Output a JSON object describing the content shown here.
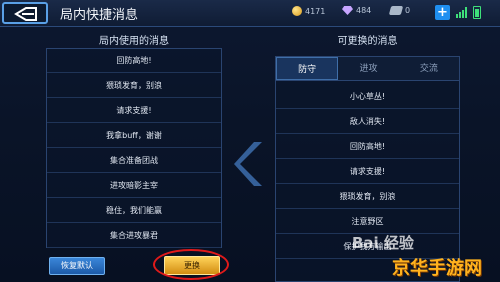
{
  "header": {
    "title": "局内快捷消息",
    "resources": {
      "gold": "4171",
      "gems": "484",
      "tickets": "0"
    }
  },
  "left_panel": {
    "title": "局内使用的消息",
    "messages": [
      "回防高地!",
      "猥琐发育，别浪",
      "请求支援!",
      "我拿buff，谢谢",
      "集合准备团战",
      "进攻暗影主宰",
      "稳住，我们能赢",
      "集合进攻暴君"
    ]
  },
  "right_panel": {
    "title": "可更换的消息",
    "tabs": [
      "防守",
      "进攻",
      "交流"
    ],
    "messages": [
      "小心草丛!",
      "敌人消失!",
      "回防高地!",
      "请求支援!",
      "猥琐发育，别浪",
      "注意野区",
      "保护我方输出"
    ]
  },
  "buttons": {
    "reset": "恢复默认",
    "change": "更换"
  },
  "watermark": {
    "baidu": "Bai 经验",
    "site": "京华手游网"
  },
  "colors": {
    "accent": "#1f8ff0",
    "gold_button": "#ffd35a",
    "highlight_circle": "#e01a1a"
  }
}
